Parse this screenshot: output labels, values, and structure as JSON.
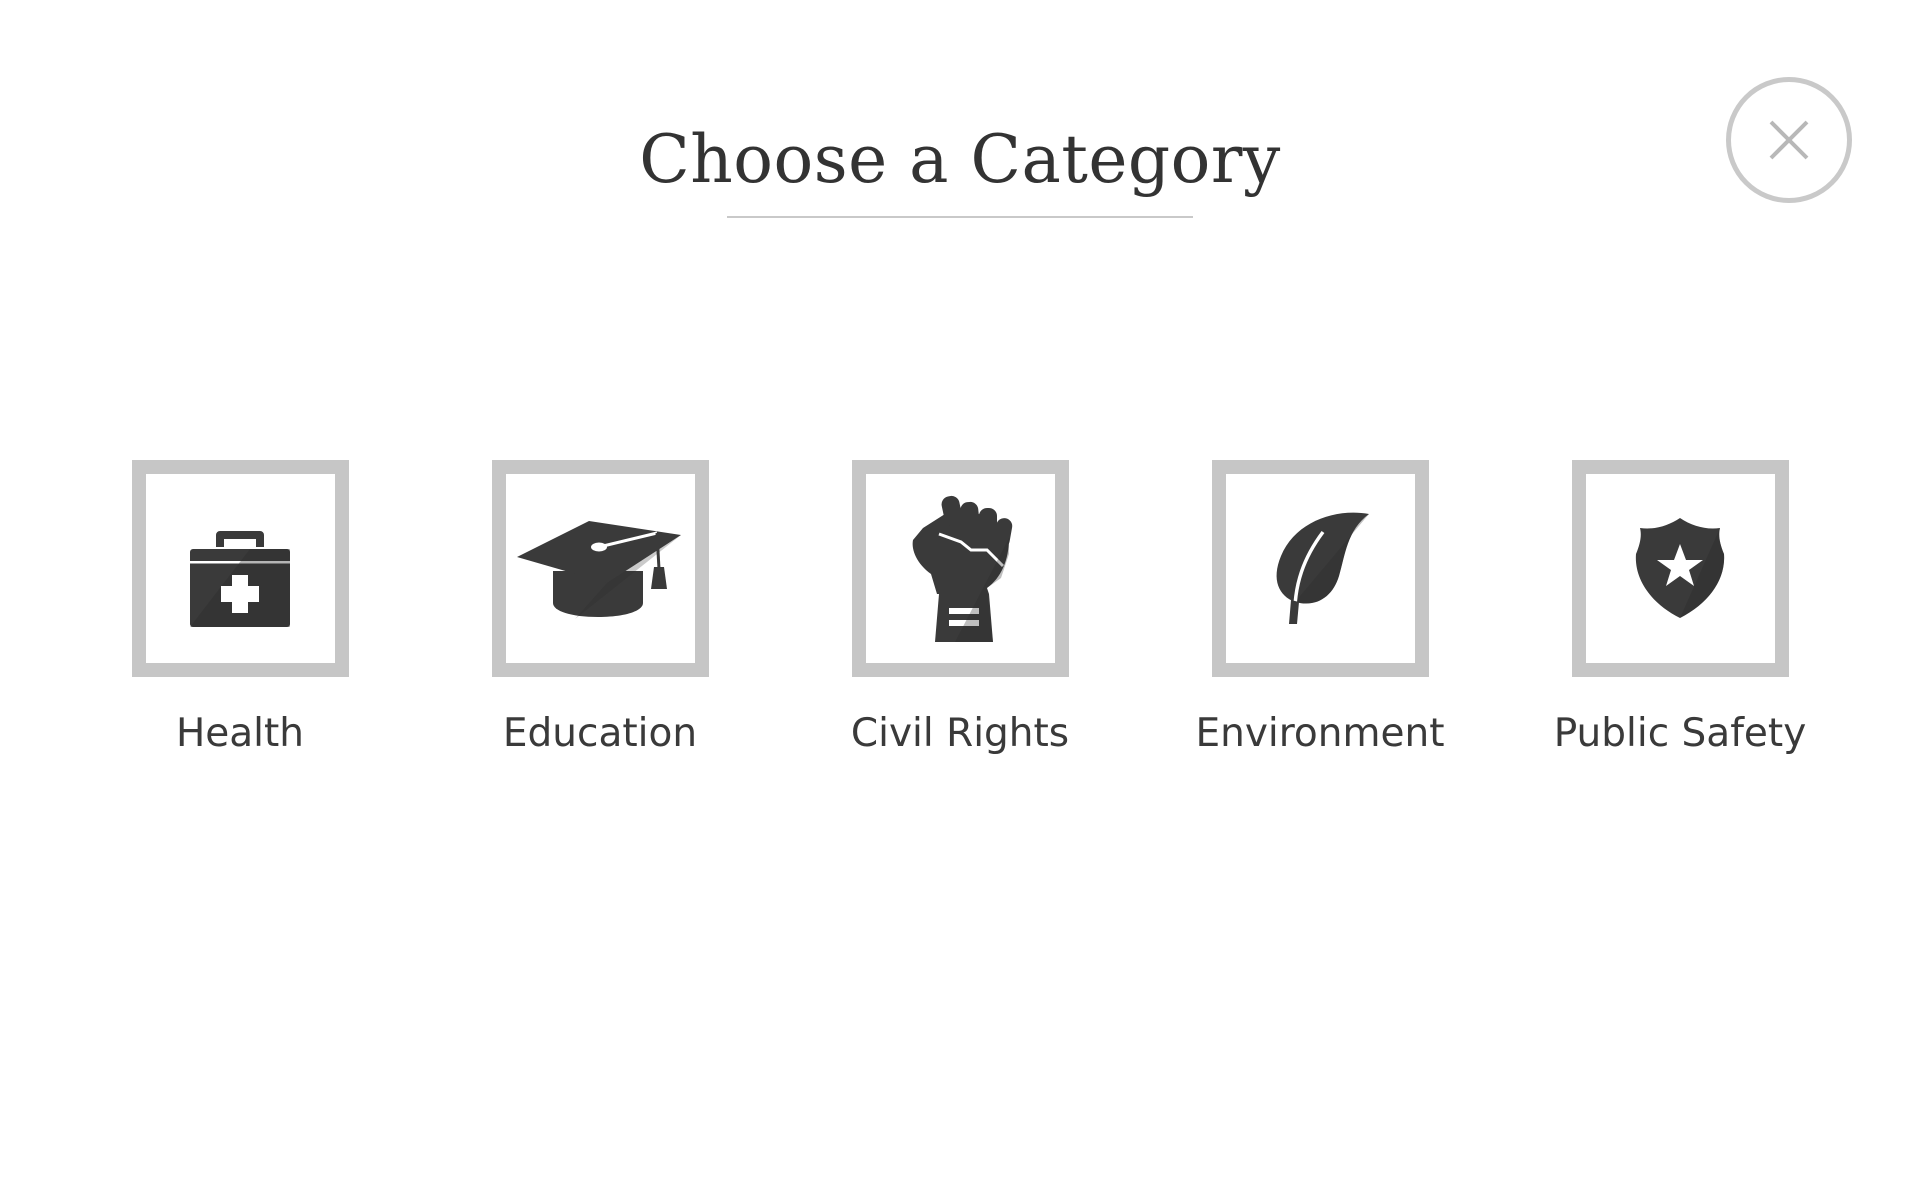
{
  "dialog": {
    "title": "Choose a Category",
    "close_icon": "close-icon"
  },
  "categories": [
    {
      "label": "Health",
      "icon": "medical-kit-icon"
    },
    {
      "label": "Education",
      "icon": "graduation-cap-icon"
    },
    {
      "label": "Civil Rights",
      "icon": "raised-fist-icon"
    },
    {
      "label": "Environment",
      "icon": "leaf-icon"
    },
    {
      "label": "Public Safety",
      "icon": "police-badge-icon"
    }
  ],
  "colors": {
    "text": "#333333",
    "frame": "#c6c6c6",
    "icon": "#3a3a3a",
    "rule": "#c9c9c9",
    "background": "#ffffff"
  }
}
